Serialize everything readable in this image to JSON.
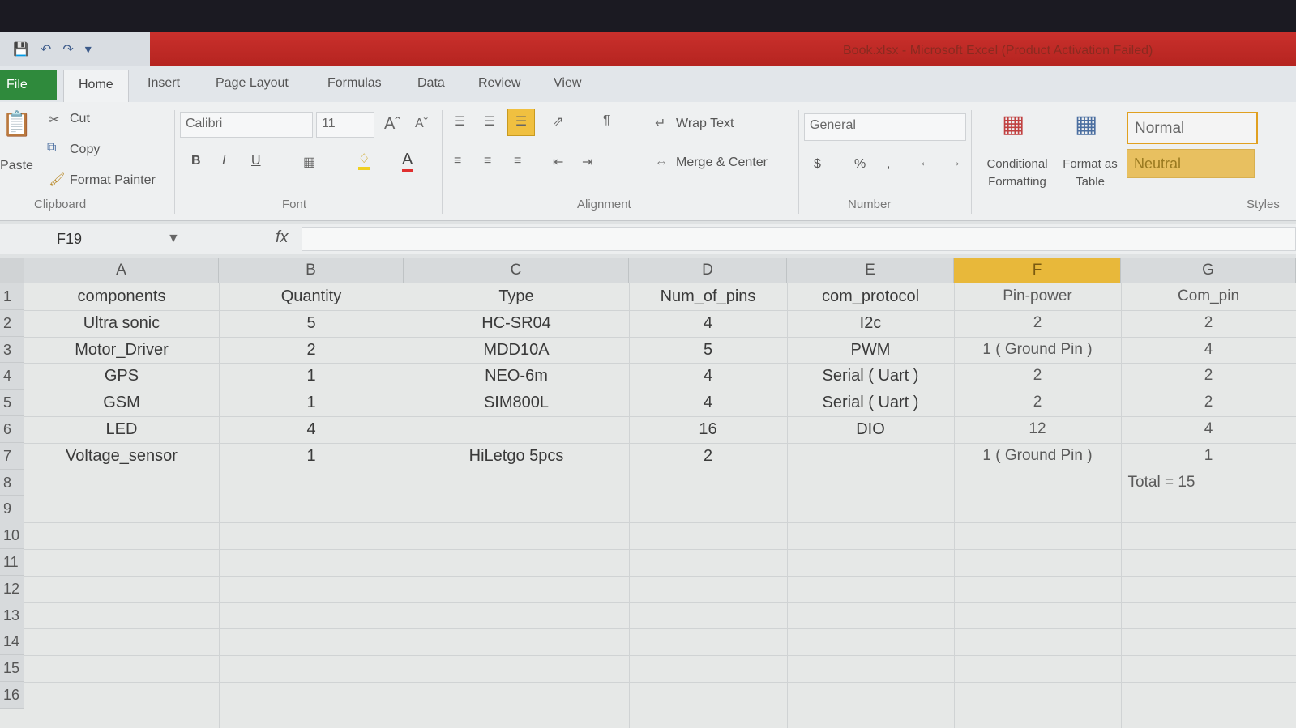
{
  "title_bar": {
    "app_title": "Book.xlsx - Microsoft Excel (Product Activation Failed)"
  },
  "tabs": [
    "File",
    "Home",
    "Insert",
    "Page Layout",
    "Formulas",
    "Data",
    "Review",
    "View"
  ],
  "ribbon": {
    "clipboard": {
      "paste": "Paste",
      "cut": "Cut",
      "copy": "Copy",
      "format_painter": "Format Painter",
      "group": "Clipboard"
    },
    "font": {
      "name": "Calibri",
      "size": "11",
      "bold": "B",
      "italic": "I",
      "underline": "U",
      "font_color": "A",
      "group": "Font"
    },
    "alignment": {
      "wrap_text": "Wrap Text",
      "merge_center": "Merge & Center",
      "group": "Alignment"
    },
    "number": {
      "format": "General",
      "currency": "$",
      "percent": "%",
      "comma": ",",
      "group": "Number"
    },
    "styles": {
      "conditional": "Conditional Formatting",
      "format_table": "Format as Table",
      "normal": "Normal",
      "neutral": "Neutral",
      "group": "Styles"
    }
  },
  "formula_bar": {
    "name_box": "F19",
    "fx": "fx",
    "value": ""
  },
  "columns": [
    "A",
    "B",
    "C",
    "D",
    "E",
    "F",
    "G"
  ],
  "row_numbers": [
    "1",
    "2",
    "3",
    "4",
    "5",
    "6",
    "7",
    "8",
    "9",
    "10",
    "11",
    "12",
    "13",
    "14",
    "15",
    "16"
  ],
  "rows": [
    [
      "components",
      "Quantity",
      "Type",
      "Num_of_pins",
      "com_protocol",
      "Pin-power",
      "Com_pin"
    ],
    [
      "Ultra sonic",
      "5",
      "HC-SR04",
      "4",
      "I2c",
      "2",
      "2"
    ],
    [
      "Motor_Driver",
      "2",
      "MDD10A",
      "5",
      "PWM",
      "1 ( Ground Pin )",
      "4"
    ],
    [
      "GPS",
      "1",
      "NEO-6m",
      "4",
      "Serial ( Uart )",
      "2",
      "2"
    ],
    [
      "GSM",
      "1",
      "SIM800L",
      "4",
      "Serial ( Uart )",
      "2",
      "2"
    ],
    [
      "LED",
      "4",
      "",
      "16",
      "DIO",
      "12",
      "4"
    ],
    [
      "Voltage_sensor",
      "1",
      "HiLetgo 5pcs",
      "2",
      "",
      "1 ( Ground Pin )",
      "1"
    ]
  ],
  "total_label": "Total = 15",
  "selected_column": "F"
}
